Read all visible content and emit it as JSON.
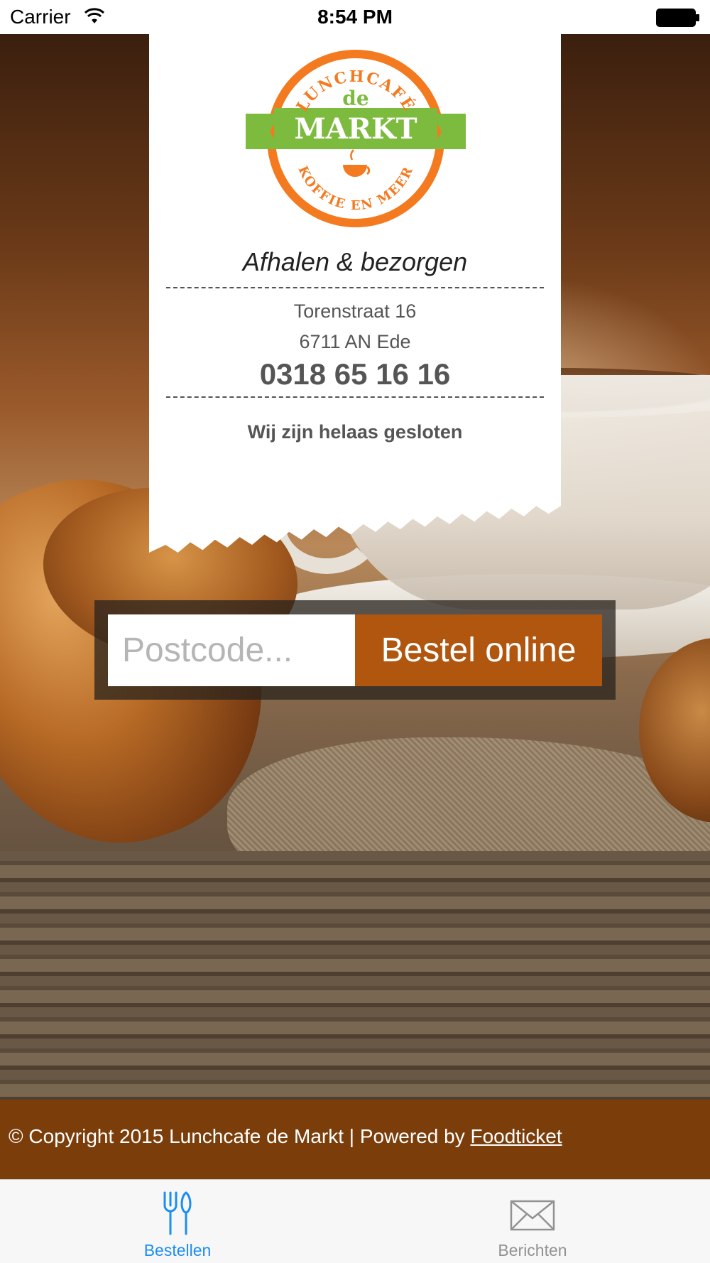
{
  "status_bar": {
    "carrier": "Carrier",
    "time": "8:54 PM",
    "icons": [
      "wifi-icon",
      "battery-icon"
    ]
  },
  "receipt": {
    "logo": {
      "top_arc": "LUNCHCAFÉ",
      "de": "de",
      "markt": "MARKT",
      "bottom_arc": "KOFFIE EN MEER",
      "colors": {
        "orange": "#f47a20",
        "green": "#7dbb3f"
      }
    },
    "tagline": "Afhalen & bezorgen",
    "street": "Torenstraat 16",
    "city": "6711 AN Ede",
    "phone": "0318 65 16 16",
    "status": "Wij zijn helaas gesloten"
  },
  "order": {
    "postcode_placeholder": "Postcode...",
    "postcode_value": "",
    "button_label": "Bestel online",
    "button_color": "#b0560f"
  },
  "footer": {
    "copyright": "© Copyright 2015 Lunchcafe de Markt | Powered by ",
    "link_label": "Foodticket",
    "background": "#7b3e0b"
  },
  "tabbar": {
    "tabs": [
      {
        "label": "Bestellen",
        "icon": "fork-knife-icon",
        "active": true
      },
      {
        "label": "Berichten",
        "icon": "envelope-icon",
        "active": false
      }
    ],
    "active_color": "#1c8df2",
    "inactive_color": "#929292"
  }
}
